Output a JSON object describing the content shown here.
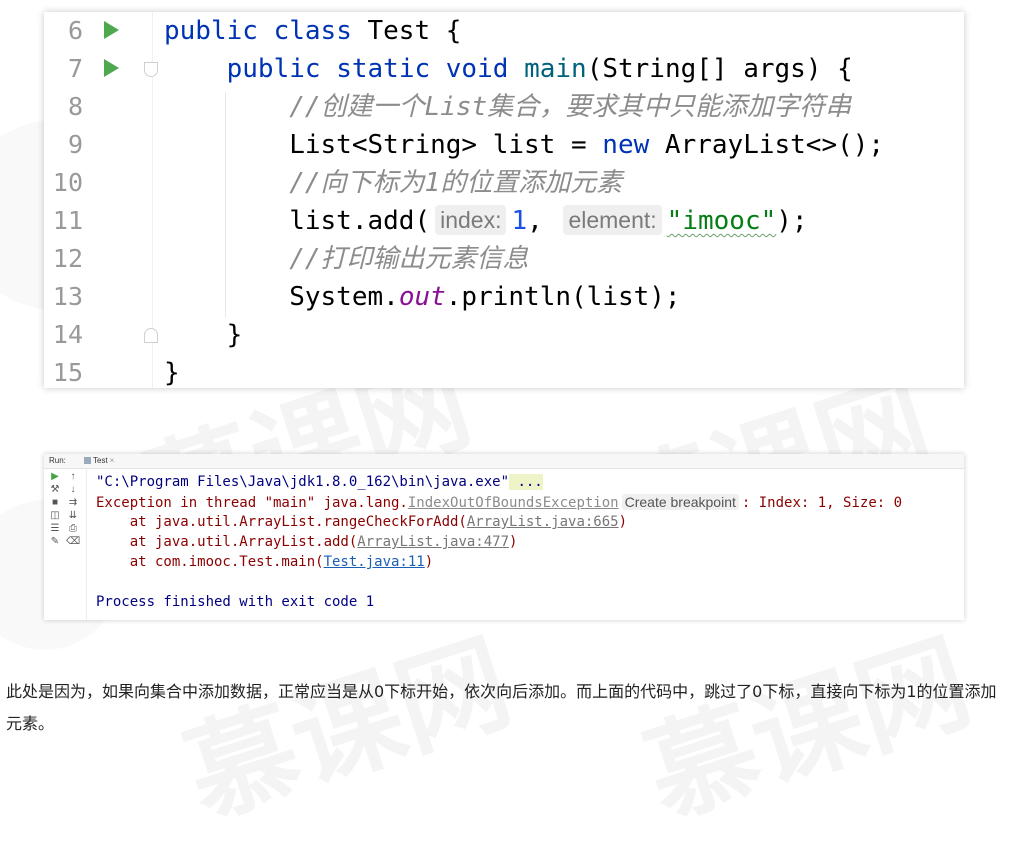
{
  "watermark": {
    "text": "慕课网"
  },
  "editor": {
    "lines": [
      {
        "number": "6",
        "run": true,
        "tokens": [
          [
            "kw",
            "public "
          ],
          [
            "kw",
            "class "
          ],
          [
            "",
            "Test {"
          ]
        ]
      },
      {
        "number": "7",
        "run": true,
        "tokens": [
          [
            "",
            "    "
          ],
          [
            "kw",
            "public "
          ],
          [
            "kw",
            "static "
          ],
          [
            "kw",
            "void "
          ],
          [
            "fn",
            "main"
          ],
          [
            "",
            "(String[] args) {"
          ]
        ]
      },
      {
        "number": "8",
        "run": false,
        "tokens": [
          [
            "",
            "        "
          ],
          [
            "cm",
            "//创建一个List集合，要求其中只能添加字符串"
          ]
        ]
      },
      {
        "number": "9",
        "run": false,
        "tokens": [
          [
            "",
            "        List<String> list = "
          ],
          [
            "kw",
            "new "
          ],
          [
            "",
            "ArrayList<>();"
          ]
        ]
      },
      {
        "number": "10",
        "run": false,
        "tokens": [
          [
            "",
            "        "
          ],
          [
            "cm",
            "//向下标为1的位置添加元素"
          ]
        ]
      },
      {
        "number": "11",
        "run": false,
        "tokens": [
          [
            "",
            "        list.add("
          ],
          [
            "hint",
            "index:"
          ],
          [
            "nm",
            "1"
          ],
          [
            "",
            ", "
          ],
          [
            "hint",
            "element:"
          ],
          [
            "st",
            "\"imooc\""
          ],
          [
            "",
            ");"
          ]
        ]
      },
      {
        "number": "12",
        "run": false,
        "tokens": [
          [
            "",
            "        "
          ],
          [
            "cm",
            "//打印输出元素信息"
          ]
        ]
      },
      {
        "number": "13",
        "run": false,
        "tokens": [
          [
            "",
            "        System."
          ],
          [
            "fld",
            "out"
          ],
          [
            "",
            ".println(list);"
          ]
        ]
      },
      {
        "number": "14",
        "run": false,
        "tokens": [
          [
            "",
            "    }"
          ]
        ]
      },
      {
        "number": "15",
        "run": false,
        "tokens": [
          [
            "",
            "}"
          ]
        ]
      }
    ]
  },
  "console": {
    "run_label": "Run:",
    "tab_label": "Test",
    "tab_close": "×",
    "command": "\"C:\\Program Files\\Java\\jdk1.8.0_162\\bin\\java.exe\"",
    "command_more": " ...",
    "exception_prefix": "Exception in thread \"main\" java.lang.",
    "exception_class": "IndexOutOfBoundsException",
    "create_breakpoint": "Create breakpoint",
    "exception_suffix": ": Index: 1, Size: 0",
    "stack": [
      {
        "prefix": "    at java.util.ArrayList.rangeCheckForAdd(",
        "link": "ArrayList.java:665",
        "suffix": ")",
        "link_style": "flink"
      },
      {
        "prefix": "    at java.util.ArrayList.add(",
        "link": "ArrayList.java:477",
        "suffix": ")",
        "link_style": "flink"
      },
      {
        "prefix": "    at com.imooc.Test.main(",
        "link": "Test.java:11",
        "suffix": ")",
        "link_style": "blink"
      }
    ],
    "exit_message": "Process finished with exit code 1"
  },
  "paragraph": "此处是因为，如果向集合中添加数据，正常应当是从0下标开始，依次向后添加。而上面的代码中，跳过了0下标，直接向下标为1的位置添加元素。"
}
